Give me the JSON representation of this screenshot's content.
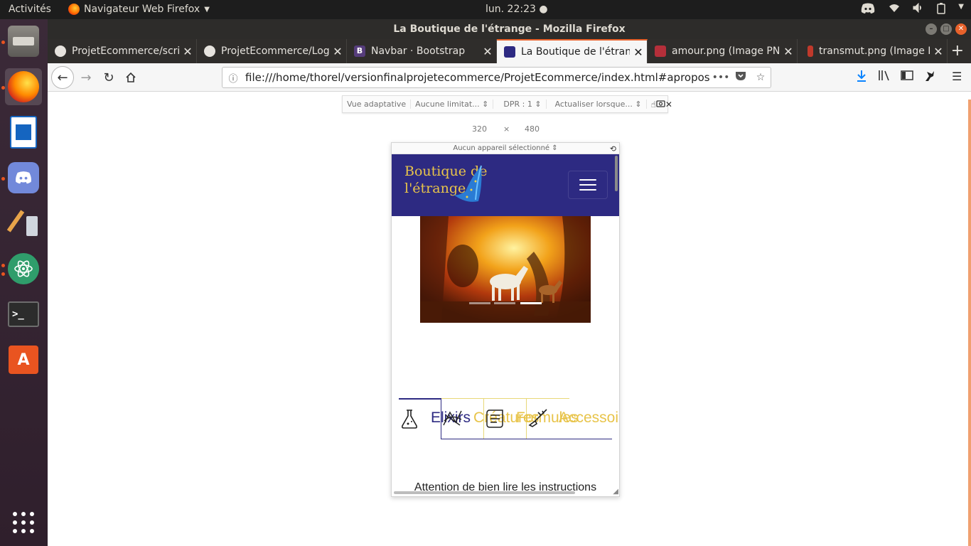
{
  "system": {
    "activities": "Activités",
    "app_name": "Navigateur Web Firefox",
    "clock": "lun. 22:23"
  },
  "dock": {
    "items": [
      "files",
      "firefox",
      "libreoffice-writer",
      "discord",
      "gimp",
      "atom",
      "terminal",
      "software-center",
      "show-apps"
    ]
  },
  "window": {
    "title": "La Boutique de l'étrange - Mozilla Firefox"
  },
  "tabs": [
    {
      "label": "ProjetEcommerce/scri",
      "icon": "github-icon"
    },
    {
      "label": "ProjetEcommerce/Log",
      "icon": "github-icon"
    },
    {
      "label": "Navbar · Bootstrap",
      "icon": "bootstrap-icon"
    },
    {
      "label": "La Boutique de l'étrang",
      "icon": "boutique-icon"
    },
    {
      "label": "amour.png (Image PNG",
      "icon": "image-icon"
    },
    {
      "label": "transmut.png (Image P",
      "icon": "image-icon"
    }
  ],
  "nav": {
    "url": "file:///home/thorel/versionfinalprojetecommerce/ProjetEcommerce/index.html#apropos",
    "more": "•••"
  },
  "rdm": {
    "mode": "Vue adaptative",
    "throttle": "Aucune limitat...",
    "dpr": "DPR : 1",
    "reload": "Actualiser lorsque...",
    "width": "320",
    "times": "×",
    "height": "480",
    "device": "Aucun appareil sélectionné"
  },
  "site": {
    "brand_line1": "Boutique de",
    "brand_line2": "l'étrange",
    "categories": [
      "Elixirs",
      "Créatures",
      "Formules",
      "Accessoires"
    ],
    "warning": "Attention de bien lire les instructions"
  },
  "colors": {
    "navbar": "#2d2a82",
    "brand": "#e8c44a",
    "accent": "#e8622b"
  }
}
